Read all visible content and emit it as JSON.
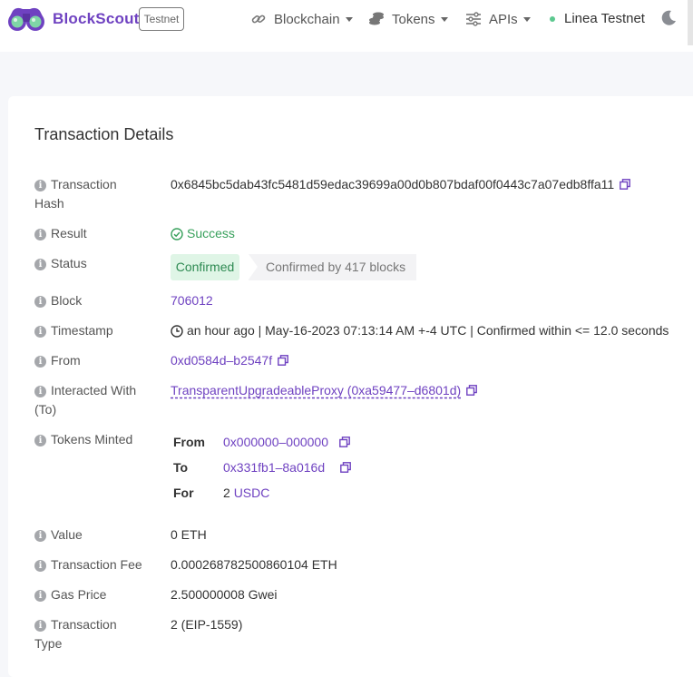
{
  "navbar": {
    "brand": "BlockScout",
    "network_badge": "Testnet",
    "menu": [
      {
        "label": "Blockchain",
        "icon": "blockchain-icon"
      },
      {
        "label": "Tokens",
        "icon": "tokens-icon"
      },
      {
        "label": "APIs",
        "icon": "apis-icon"
      }
    ],
    "network_name": "Linea Testnet",
    "theme_icon": "moon-icon"
  },
  "colors": {
    "accent": "#6f42c1",
    "success": "#37a05b",
    "confirmed_bg": "#dff5e6"
  },
  "details": {
    "title": "Transaction Details",
    "hash": {
      "label_line1": "Transaction",
      "label_line2": "Hash",
      "value": "0x6845bc5dab43fc5481d59edac39699a00d0b807bdaf00f0443c7a07edb8ffa11"
    },
    "result": {
      "label": "Result",
      "value": "Success"
    },
    "status": {
      "label": "Status",
      "badge": "Confirmed",
      "confirmations": "Confirmed by 417 blocks"
    },
    "block": {
      "label": "Block",
      "value": "706012"
    },
    "timestamp": {
      "label": "Timestamp",
      "value": "an hour ago | May-16-2023 07:13:14 AM +-4 UTC | Confirmed within <= 12.0 seconds"
    },
    "from": {
      "label": "From",
      "value": "0xd0584d–b2547f"
    },
    "interacted": {
      "label_line1": "Interacted With",
      "label_line2": "(To)",
      "value": "TransparentUpgradeableProxy (0xa59477–d6801d)"
    },
    "tokens_minted": {
      "label": "Tokens Minted",
      "from_key": "From",
      "from_val": "0x000000–000000",
      "to_key": "To",
      "to_val": "0x331fb1–8a016d",
      "for_key": "For",
      "for_amount": "2",
      "for_token": "USDC"
    },
    "value": {
      "label": "Value",
      "value": "0 ETH"
    },
    "fee": {
      "label": "Transaction Fee",
      "value": "0.000268782500860104 ETH"
    },
    "gas_price": {
      "label": "Gas Price",
      "value": "2.500000008 Gwei"
    },
    "tx_type": {
      "label_line1": "Transaction",
      "label_line2": "Type",
      "value": "2 (EIP-1559)"
    }
  }
}
